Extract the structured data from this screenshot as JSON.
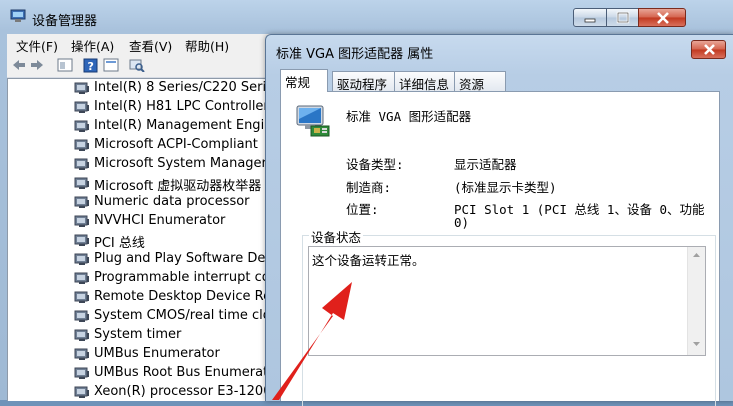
{
  "main_window": {
    "title": "设备管理器",
    "menu": [
      "文件(F)",
      "操作(A)",
      "查看(V)",
      "帮助(H)"
    ]
  },
  "device_tree": [
    "Intel(R) 8 Series/C220 Serie",
    "Intel(R) H81 LPC Controller",
    "Intel(R) Management Engin",
    "Microsoft ACPI-Compliant",
    "Microsoft System Manager",
    "Microsoft 虚拟驱动器枚举器",
    "Numeric data processor",
    "NVVHCI Enumerator",
    "PCI 总线",
    "Plug and Play Software Dev",
    "Programmable interrupt co",
    "Remote Desktop Device Re",
    "System CMOS/real time clo",
    "System timer",
    "UMBus Enumerator",
    "UMBus Root Bus Enumerato",
    "Xeon(R) processor E3-1200"
  ],
  "dialog": {
    "title": "标准 VGA 图形适配器 属性",
    "tabs": [
      "常规",
      "驱动程序",
      "详细信息",
      "资源"
    ],
    "device_name": "标准 VGA 图形适配器",
    "properties": [
      {
        "label": "设备类型:",
        "value": "显示适配器"
      },
      {
        "label": "制造商:",
        "value": "(标准显示卡类型)"
      },
      {
        "label": "位置:",
        "value": "PCI Slot 1 (PCI 总线 1、设备 0、功能"
      },
      {
        "label": "",
        "value": "0)"
      }
    ],
    "status_legend": "设备状态",
    "status_text": "这个设备运转正常。"
  },
  "colors": {
    "annotation_arrow": "#e0201b",
    "titlebar": "#b5cbe4"
  }
}
